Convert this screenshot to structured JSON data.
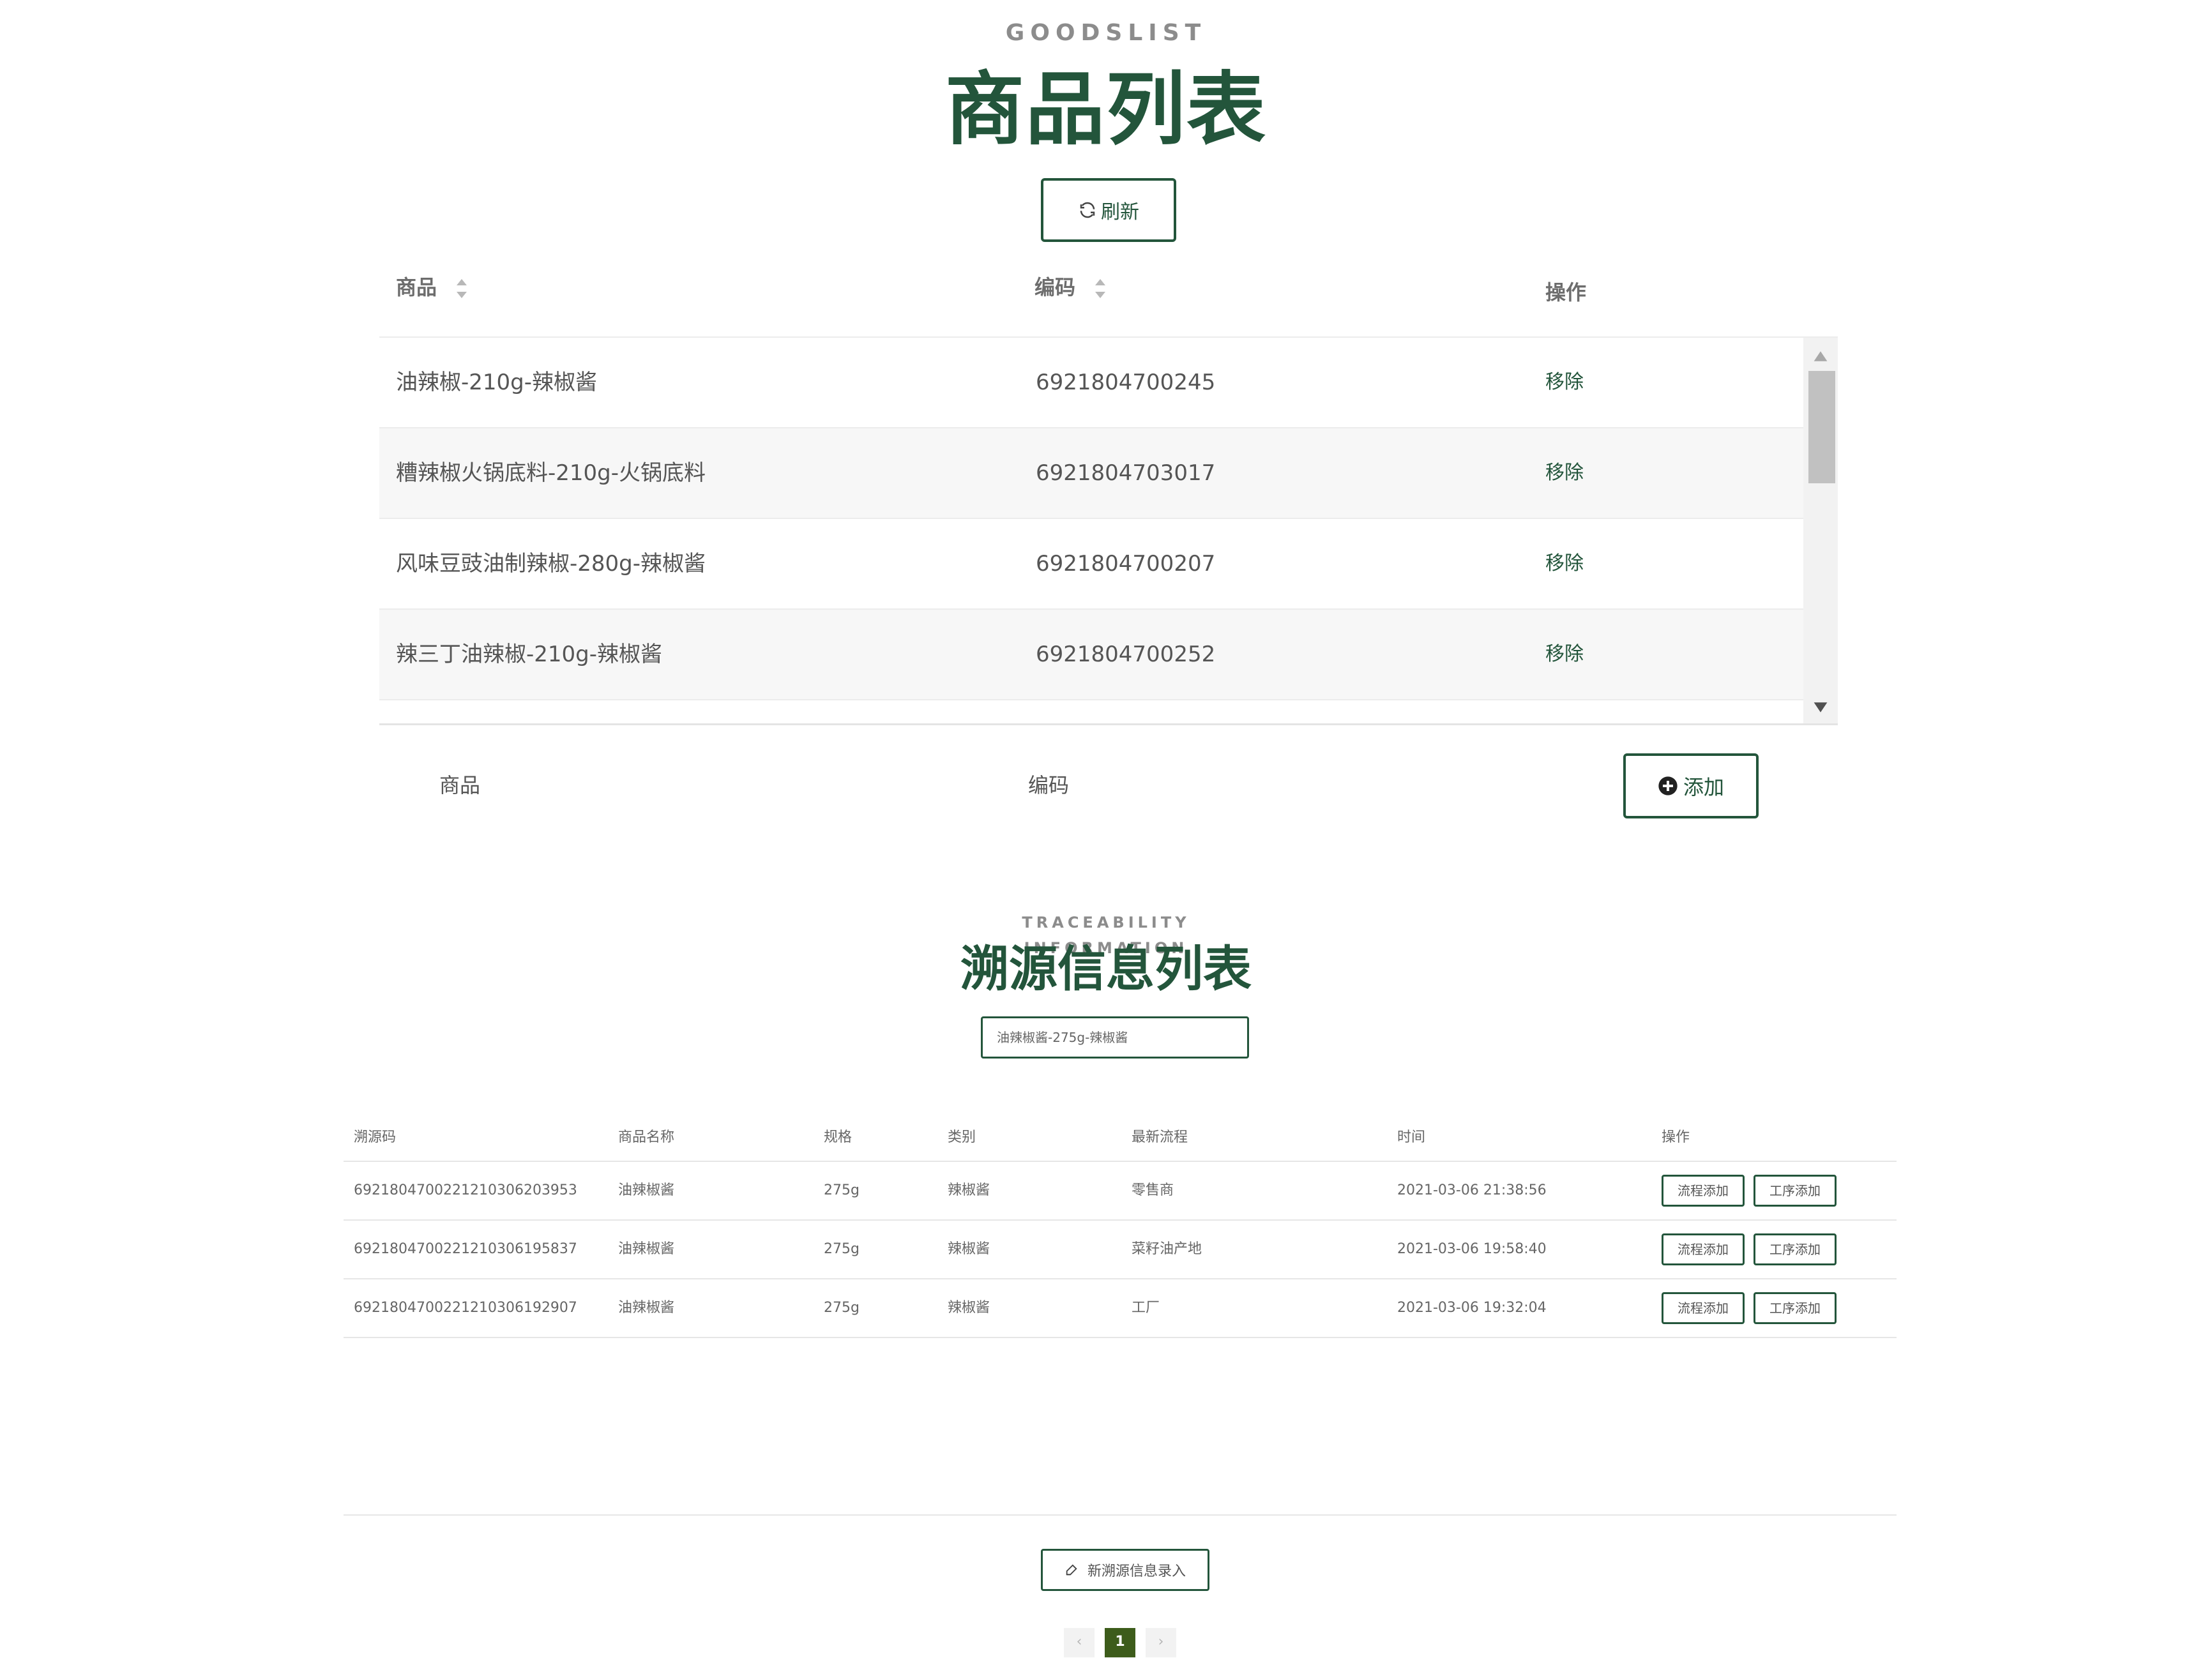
{
  "goods_section": {
    "eyebrow": "GOODSLIST",
    "title": "商品列表",
    "refresh_label": "刷新",
    "columns": {
      "product": "商品",
      "code": "编码",
      "action": "操作"
    },
    "rows": [
      {
        "name": "油辣椒-210g-辣椒酱",
        "code": "6921804700245",
        "action": "移除"
      },
      {
        "name": "糟辣椒火锅底料-210g-火锅底料",
        "code": "6921804703017",
        "action": "移除"
      },
      {
        "name": "风味豆豉油制辣椒-280g-辣椒酱",
        "code": "6921804700207",
        "action": "移除"
      },
      {
        "name": "辣三丁油辣椒-210g-辣椒酱",
        "code": "6921804700252",
        "action": "移除"
      }
    ],
    "add_row": {
      "product_label": "商品",
      "code_label": "编码",
      "add_label": "添加"
    }
  },
  "trace_section": {
    "eyebrow": "TRACEABILITY INFORMATION",
    "title": "溯源信息列表",
    "selected_product": "油辣椒酱-275g-辣椒酱",
    "columns": {
      "trace_code": "溯源码",
      "product_name": "商品名称",
      "spec": "规格",
      "category": "类别",
      "latest_process": "最新流程",
      "time": "时间",
      "action": "操作"
    },
    "rows": [
      {
        "trace_code": "6921804700221210306203953",
        "product_name": "油辣椒酱",
        "spec": "275g",
        "category": "辣椒酱",
        "latest_process": "零售商",
        "time": "2021-03-06 21:38:56",
        "btn_flow": "流程添加",
        "btn_step": "工序添加"
      },
      {
        "trace_code": "6921804700221210306195837",
        "product_name": "油辣椒酱",
        "spec": "275g",
        "category": "辣椒酱",
        "latest_process": "菜籽油产地",
        "time": "2021-03-06 19:58:40",
        "btn_flow": "流程添加",
        "btn_step": "工序添加"
      },
      {
        "trace_code": "6921804700221210306192907",
        "product_name": "油辣椒酱",
        "spec": "275g",
        "category": "辣椒酱",
        "latest_process": "工厂",
        "time": "2021-03-06 19:32:04",
        "btn_flow": "流程添加",
        "btn_step": "工序添加"
      }
    ],
    "new_entry_label": "新溯源信息录入",
    "pagination": {
      "prev": "‹",
      "current": "1",
      "next": "›"
    }
  },
  "colors": {
    "brand_green": "#23553b",
    "page_active": "#3d5c1b"
  },
  "icons": [
    "refresh-icon",
    "sort-icon",
    "plus-circle-icon",
    "edit-icon",
    "chevron-left-icon",
    "chevron-right-icon"
  ]
}
